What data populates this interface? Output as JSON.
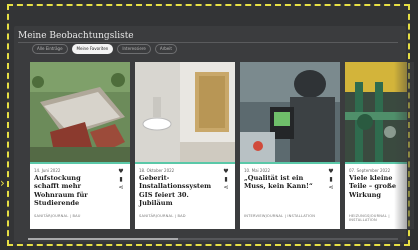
{
  "section": {
    "title": "Meine Beobachtungsliste"
  },
  "filters": [
    {
      "label": "Alle Einträge",
      "active": false
    },
    {
      "label": "Meine Favoriten",
      "active": true
    },
    {
      "label": "Interessiere",
      "active": false
    },
    {
      "label": "Arbeit",
      "active": false
    }
  ],
  "cards": [
    {
      "date": "14. Juni 2022",
      "headline": "Aufstockung schafft mehr Wohnraum für Studierende",
      "meta": "SANITÄRJOURNAL | BAU",
      "image_icon": "aerial-building-photo"
    },
    {
      "date": "18. Oktober 2022",
      "headline": "Geberit-Installationssystem GIS feiert 30. Jubiläum",
      "meta": "SANITÄRJOURNAL | BAD",
      "image_icon": "bathroom-photo"
    },
    {
      "date": "10. Mai 2022",
      "headline": "„Qualität ist ein Muss, kein Kann!“",
      "meta": "INTERVIEWJOURNAL | INSTALLATION",
      "image_icon": "technician-photo"
    },
    {
      "date": "07. September 2022",
      "headline": "Viele kleine Teile – große Wirkung",
      "meta": "HEIZUNGSJOURNAL | INSTALLATION",
      "image_icon": "pipes-photo"
    }
  ],
  "colors": {
    "accent": "#5ac8a8",
    "highlight": "#e6df45",
    "background": "#3b3c3e"
  }
}
